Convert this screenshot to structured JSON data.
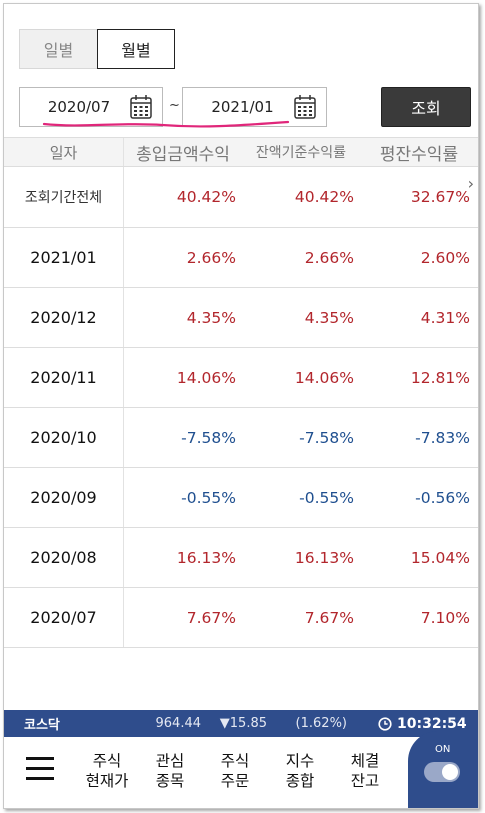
{
  "tabs": [
    {
      "label": "일별",
      "active": false
    },
    {
      "label": "월별",
      "active": true
    }
  ],
  "period": {
    "start": "2020/07",
    "separator": "~",
    "end": "2021/01",
    "search_label": "조회"
  },
  "table": {
    "headers": [
      "일자",
      "총입금액수익",
      "잔액기준수익률",
      "평잔수익률"
    ],
    "rows": [
      {
        "date": "조회기간전체",
        "total": "40.42%",
        "balance": "40.42%",
        "avg": "32.67%",
        "sign": "pos"
      },
      {
        "date": "2021/01",
        "total": "2.66%",
        "balance": "2.66%",
        "avg": "2.60%",
        "sign": "pos"
      },
      {
        "date": "2020/12",
        "total": "4.35%",
        "balance": "4.35%",
        "avg": "4.31%",
        "sign": "pos"
      },
      {
        "date": "2020/11",
        "total": "14.06%",
        "balance": "14.06%",
        "avg": "12.81%",
        "sign": "pos"
      },
      {
        "date": "2020/10",
        "total": "-7.58%",
        "balance": "-7.58%",
        "avg": "-7.83%",
        "sign": "neg"
      },
      {
        "date": "2020/09",
        "total": "-0.55%",
        "balance": "-0.55%",
        "avg": "-0.56%",
        "sign": "neg"
      },
      {
        "date": "2020/08",
        "total": "16.13%",
        "balance": "16.13%",
        "avg": "15.04%",
        "sign": "pos"
      },
      {
        "date": "2020/07",
        "total": "7.67%",
        "balance": "7.67%",
        "avg": "7.10%",
        "sign": "pos"
      }
    ]
  },
  "ticker": {
    "name": "코스닥",
    "price": "964.44",
    "change": "▼15.85",
    "percent": "(1.62%)",
    "time": "10:32:54"
  },
  "nav": {
    "items": [
      {
        "line1": "주식",
        "line2": "현재가"
      },
      {
        "line1": "관심",
        "line2": "종목"
      },
      {
        "line1": "주식",
        "line2": "주문"
      },
      {
        "line1": "지수",
        "line2": "종합"
      },
      {
        "line1": "체결",
        "line2": "잔고"
      }
    ],
    "toggle_label": "ON"
  },
  "colors": {
    "positive": "#b2262c",
    "negative": "#1f4f8f",
    "bar": "#2f4d8c",
    "underline": "#e0267a"
  }
}
